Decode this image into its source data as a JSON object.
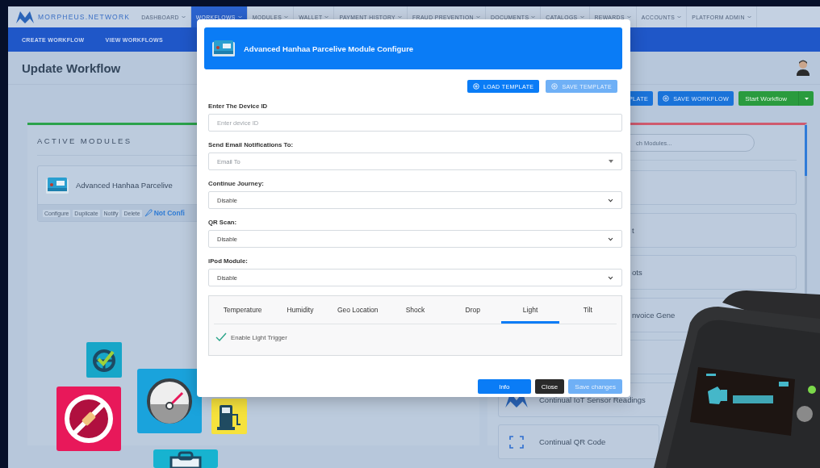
{
  "brand": {
    "name": "MORPHEUS.NETWORK"
  },
  "nav": [
    {
      "label": "DASHBOARD",
      "selected": false
    },
    {
      "label": "WORKFLOWS",
      "selected": true
    },
    {
      "label": "MODULES",
      "selected": false
    },
    {
      "label": "WALLET",
      "selected": false
    },
    {
      "label": "PAYMENT HISTORY",
      "selected": false
    },
    {
      "label": "FRAUD PREVENTION",
      "selected": false
    },
    {
      "label": "DOCUMENTS",
      "selected": false
    },
    {
      "label": "CATALOGS",
      "selected": false
    },
    {
      "label": "REWARDS",
      "selected": false
    },
    {
      "label": "ACCOUNTS",
      "selected": false
    },
    {
      "label": "PLATFORM ADMIN",
      "selected": false
    }
  ],
  "subnav": [
    "CREATE WORKFLOW",
    "VIEW WORKFLOWS"
  ],
  "page": {
    "title": "Update Workflow"
  },
  "toolbar": [
    {
      "label": "PLATE",
      "kind": "cut"
    },
    {
      "label": "SAVE WORKFLOW",
      "kind": "primary"
    },
    {
      "label": "Start Workflow",
      "kind": "split"
    }
  ],
  "active_modules": {
    "title": "ACTIVE MODULES",
    "modules": [
      {
        "name": "Advanced Hanhaa Parcelive",
        "actions": [
          "Configure",
          "Duplicate",
          "Notify",
          "Delete"
        ],
        "status": "Not Confi"
      }
    ]
  },
  "module_library": {
    "search": {
      "placeholder": "ch Modules..."
    },
    "items": [
      {
        "kind": "blank"
      },
      {
        "kind": "fragment",
        "label": "t"
      },
      {
        "kind": "fragment",
        "label": "ots"
      },
      {
        "kind": "fragment",
        "label": "nvoice Gene"
      },
      {
        "kind": "blank"
      },
      {
        "kind": "brand-module",
        "label": "Continual IoT Sensor Readings"
      },
      {
        "kind": "scan-module",
        "label": "Continual QR Code"
      }
    ]
  },
  "modal": {
    "title": "Advanced Hanhaa Parcelive Module Configure",
    "template_buttons": [
      {
        "label": "LOAD TEMPLATE",
        "disabled": false
      },
      {
        "label": "SAVE TEMPLATE",
        "disabled": true
      }
    ],
    "fields": [
      {
        "label": "Enter The Device ID",
        "kind": "input",
        "placeholder": "Enter device ID"
      },
      {
        "label": "Send Email Notifications To:",
        "kind": "multiselect",
        "placeholder": "Email To"
      },
      {
        "label": "Continue Journey:",
        "kind": "select",
        "value": "Disable"
      },
      {
        "label": "QR Scan:",
        "kind": "select",
        "value": "Disable"
      },
      {
        "label": "iPod Module:",
        "kind": "select",
        "value": "Disable"
      }
    ],
    "sensor_tabs": [
      {
        "label": "Temperature",
        "selected": false
      },
      {
        "label": "Humidity",
        "selected": false
      },
      {
        "label": "Geo Location",
        "selected": false
      },
      {
        "label": "Shock",
        "selected": false
      },
      {
        "label": "Drop",
        "selected": false
      },
      {
        "label": "Light",
        "selected": true
      },
      {
        "label": "Tilt",
        "selected": false
      }
    ],
    "trigger": {
      "label": "Enable Light Trigger",
      "checked": true
    },
    "footer_buttons": [
      {
        "label": "Info",
        "kind": "primary",
        "disabled": false
      },
      {
        "label": "Close",
        "kind": "dark",
        "disabled": false
      },
      {
        "label": "Save changes",
        "kind": "primary",
        "disabled": true
      }
    ]
  }
}
